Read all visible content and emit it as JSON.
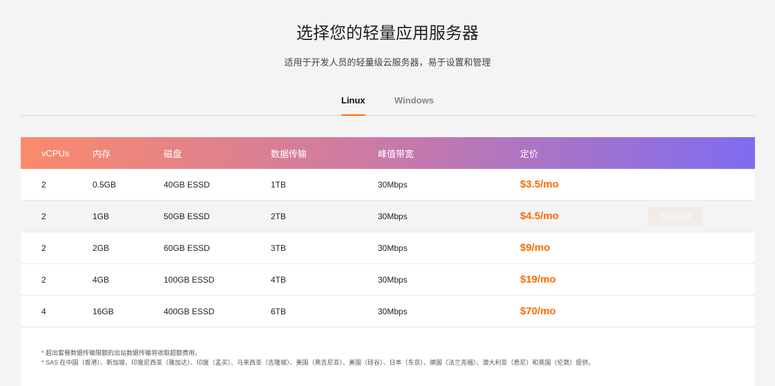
{
  "title": "选择您的轻量应用服务器",
  "subtitle": "适用于开发人员的轻量级云服务器，易于设置和管理",
  "tabs": [
    {
      "label": "Linux",
      "active": true
    },
    {
      "label": "Windows",
      "active": false
    }
  ],
  "table": {
    "headers": [
      "vCPUs",
      "内存",
      "磁盘",
      "数据传输",
      "峰值带宽",
      "定价"
    ],
    "rows": [
      [
        "2",
        "0.5GB",
        "40GB ESSD",
        "1TB",
        "30Mbps",
        "$3.5/mo"
      ],
      [
        "2",
        "1GB",
        "50GB ESSD",
        "2TB",
        "30Mbps",
        "$4.5/mo"
      ],
      [
        "2",
        "2GB",
        "60GB ESSD",
        "3TB",
        "30Mbps",
        "$9/mo"
      ],
      [
        "2",
        "4GB",
        "100GB ESSD",
        "4TB",
        "30Mbps",
        "$19/mo"
      ],
      [
        "4",
        "16GB",
        "400GB ESSD",
        "6TB",
        "30Mbps",
        "$70/mo"
      ]
    ],
    "buy_label": "立即购买"
  },
  "notes": [
    "* 超出套餐数据传输限额的出站数据传输将收取超额费用。",
    "* SAS 在中国（香港）、新加坡、印度尼西亚（雅加达）、印度（孟买）、马来西亚（吉隆坡）、美国（弗吉尼亚）、美国（硅谷）、日本（东京）、德国（法兰克福）、澳大利亚（悉尼）和英国（伦敦）提供。"
  ],
  "colors": {
    "accent": "#ff6a00",
    "gradient_start": "#fb8a6c",
    "gradient_end": "#7f6cf0"
  }
}
